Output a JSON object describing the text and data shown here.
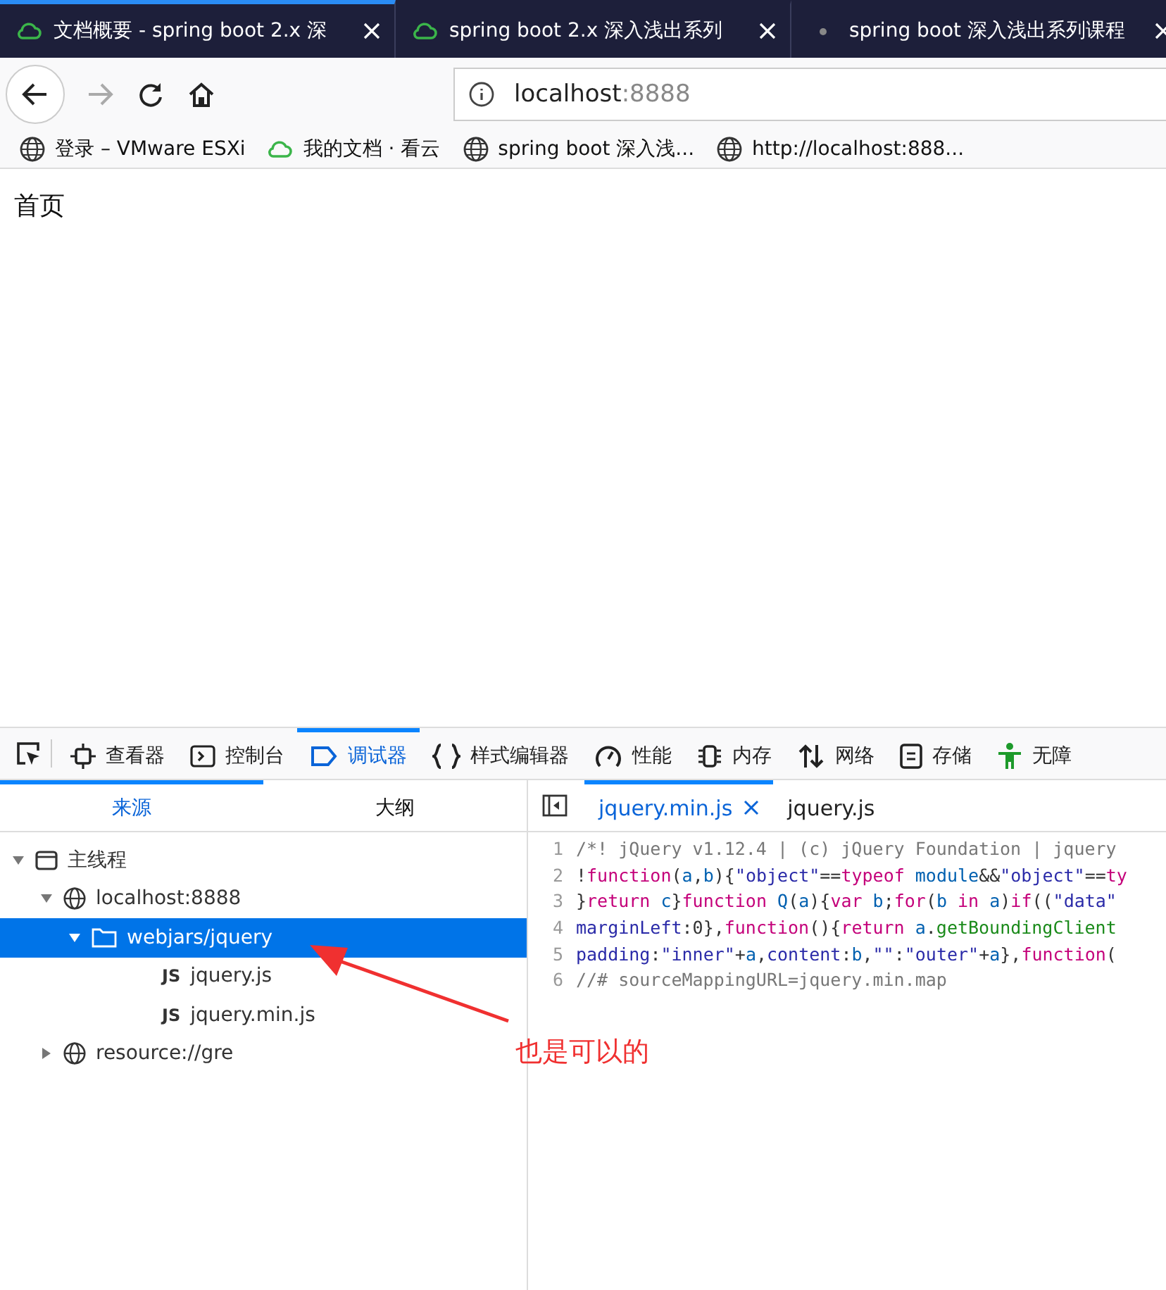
{
  "browser_tabs": [
    {
      "title": "文档概要 - spring boot 2.x 深",
      "selected": true
    },
    {
      "title": "spring boot 2.x 深入浅出系列",
      "selected": false
    },
    {
      "title": "spring boot 深入浅出系列课程",
      "selected": false
    }
  ],
  "address_bar": {
    "host": "localhost",
    "port": ":8888"
  },
  "bookmarks": [
    {
      "label": "登录 – VMware ESXi"
    },
    {
      "label": "我的文档 · 看云"
    },
    {
      "label": "spring boot 深入浅..."
    },
    {
      "label": "http://localhost:888..."
    }
  ],
  "page": {
    "heading": "首页"
  },
  "devtools": {
    "tools": [
      {
        "label": "查看器",
        "selected": false
      },
      {
        "label": "控制台",
        "selected": false
      },
      {
        "label": "调试器",
        "selected": true
      },
      {
        "label": "样式编辑器",
        "selected": false
      },
      {
        "label": "性能",
        "selected": false
      },
      {
        "label": "内存",
        "selected": false
      },
      {
        "label": "网络",
        "selected": false
      },
      {
        "label": "存储",
        "selected": false
      },
      {
        "label": "无障",
        "selected": false
      }
    ],
    "side_tabs": [
      {
        "label": "来源",
        "selected": true
      },
      {
        "label": "大纲",
        "selected": false
      }
    ],
    "tree": [
      {
        "label": "主线程",
        "kind": "thread",
        "expanded": true,
        "selected": false,
        "children": [
          {
            "label": "localhost:8888",
            "kind": "host",
            "expanded": true,
            "selected": false,
            "children": [
              {
                "label": "webjars/jquery",
                "kind": "folder",
                "expanded": true,
                "selected": true,
                "children": [
                  {
                    "label": "jquery.js",
                    "kind": "file",
                    "type_label": "JS",
                    "selected": false
                  },
                  {
                    "label": "jquery.min.js",
                    "kind": "file",
                    "type_label": "JS",
                    "selected": false
                  }
                ]
              }
            ]
          },
          {
            "label": "resource://gre",
            "kind": "host",
            "expanded": false,
            "selected": false
          }
        ]
      }
    ],
    "editor_tabs": [
      {
        "label": "jquery.min.js",
        "selected": true
      },
      {
        "label": "jquery.js",
        "selected": false
      }
    ],
    "code_lines": [
      {
        "number": "1",
        "tokens": [
          {
            "kind": "comment",
            "text": "/*! jQuery v1.12.4 | (c) jQuery Foundation | jquery"
          }
        ]
      },
      {
        "number": "2",
        "tokens": [
          {
            "kind": "plain",
            "text": "!"
          },
          {
            "kind": "keyword",
            "text": "function"
          },
          {
            "kind": "plain",
            "text": "("
          },
          {
            "kind": "var",
            "text": "a"
          },
          {
            "kind": "plain",
            "text": ","
          },
          {
            "kind": "var",
            "text": "b"
          },
          {
            "kind": "plain",
            "text": "){"
          },
          {
            "kind": "string",
            "text": "\"object\""
          },
          {
            "kind": "plain",
            "text": "=="
          },
          {
            "kind": "keyword",
            "text": "typeof"
          },
          {
            "kind": "var",
            "text": " module"
          },
          {
            "kind": "plain",
            "text": "&&"
          },
          {
            "kind": "string",
            "text": "\"object\""
          },
          {
            "kind": "plain",
            "text": "=="
          },
          {
            "kind": "keyword",
            "text": "ty"
          }
        ]
      },
      {
        "number": "3",
        "tokens": [
          {
            "kind": "plain",
            "text": "}"
          },
          {
            "kind": "keyword",
            "text": "return"
          },
          {
            "kind": "var",
            "text": " c"
          },
          {
            "kind": "plain",
            "text": "}"
          },
          {
            "kind": "keyword",
            "text": "function"
          },
          {
            "kind": "var",
            "text": " Q"
          },
          {
            "kind": "plain",
            "text": "("
          },
          {
            "kind": "var",
            "text": "a"
          },
          {
            "kind": "plain",
            "text": "){"
          },
          {
            "kind": "keyword",
            "text": "var"
          },
          {
            "kind": "var",
            "text": " b"
          },
          {
            "kind": "plain",
            "text": ";"
          },
          {
            "kind": "keyword",
            "text": "for"
          },
          {
            "kind": "plain",
            "text": "("
          },
          {
            "kind": "var",
            "text": "b"
          },
          {
            "kind": "keyword",
            "text": " in"
          },
          {
            "kind": "var",
            "text": " a"
          },
          {
            "kind": "plain",
            "text": ")"
          },
          {
            "kind": "keyword",
            "text": "if"
          },
          {
            "kind": "plain",
            "text": "(("
          },
          {
            "kind": "string",
            "text": "\"data\""
          }
        ]
      },
      {
        "number": "4",
        "tokens": [
          {
            "kind": "string",
            "text": "marginLeft"
          },
          {
            "kind": "plain",
            "text": ":0},"
          },
          {
            "kind": "keyword",
            "text": "function"
          },
          {
            "kind": "plain",
            "text": "(){"
          },
          {
            "kind": "keyword",
            "text": "return"
          },
          {
            "kind": "var",
            "text": " a"
          },
          {
            "kind": "plain",
            "text": "."
          },
          {
            "kind": "method",
            "text": "getBoundingClient"
          }
        ]
      },
      {
        "number": "5",
        "tokens": [
          {
            "kind": "string",
            "text": "padding"
          },
          {
            "kind": "plain",
            "text": ":"
          },
          {
            "kind": "string",
            "text": "\"inner\""
          },
          {
            "kind": "plain",
            "text": "+"
          },
          {
            "kind": "var",
            "text": "a"
          },
          {
            "kind": "plain",
            "text": ","
          },
          {
            "kind": "string",
            "text": "content"
          },
          {
            "kind": "plain",
            "text": ":"
          },
          {
            "kind": "var",
            "text": "b"
          },
          {
            "kind": "plain",
            "text": ","
          },
          {
            "kind": "string",
            "text": "\"\""
          },
          {
            "kind": "plain",
            "text": ":"
          },
          {
            "kind": "string",
            "text": "\"outer\""
          },
          {
            "kind": "plain",
            "text": "+"
          },
          {
            "kind": "var",
            "text": "a"
          },
          {
            "kind": "plain",
            "text": "},"
          },
          {
            "kind": "keyword",
            "text": "function"
          },
          {
            "kind": "plain",
            "text": "("
          }
        ]
      },
      {
        "number": "6",
        "tokens": [
          {
            "kind": "comment",
            "text": "//# sourceMappingURL=jquery.min.map"
          }
        ]
      }
    ]
  },
  "annotation": {
    "text": "也是可以的"
  }
}
